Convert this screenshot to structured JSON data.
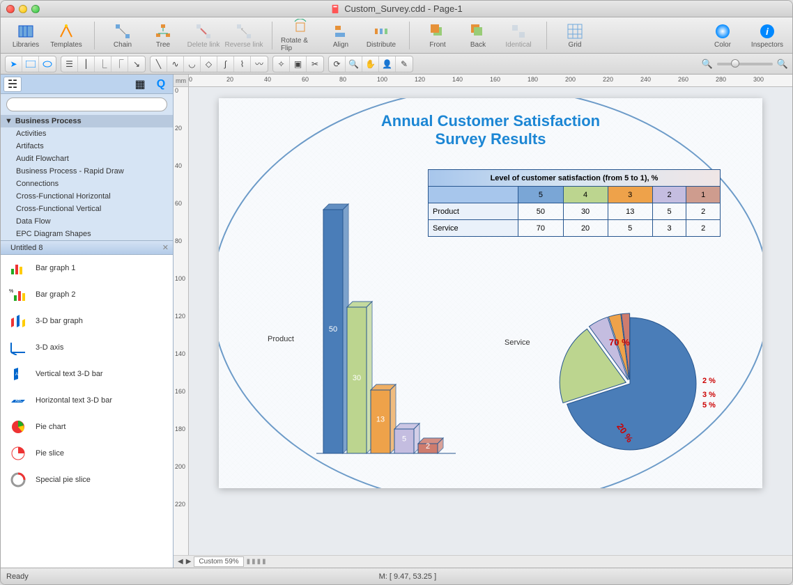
{
  "window": {
    "title": "Custom_Survey.cdd - Page-1"
  },
  "toolbar": {
    "libraries": "Libraries",
    "templates": "Templates",
    "chain": "Chain",
    "tree": "Tree",
    "delete_link": "Delete link",
    "reverse_link": "Reverse link",
    "rotate_flip": "Rotate & Flip",
    "align": "Align",
    "distribute": "Distribute",
    "front": "Front",
    "back": "Back",
    "identical": "Identical",
    "grid": "Grid",
    "color": "Color",
    "inspectors": "Inspectors"
  },
  "sidebar": {
    "search_placeholder": "",
    "root": "Business Process",
    "items": [
      "Activities",
      "Artifacts",
      "Audit Flowchart",
      "Business Process - Rapid Draw",
      "Connections",
      "Cross-Functional Horizontal",
      "Cross-Functional Vertical",
      "Data Flow",
      "EPC Diagram Shapes"
    ],
    "selected_lib": "Untitled 8",
    "shapes": [
      "Bar graph   1",
      "Bar graph   2",
      "3-D bar graph",
      "3-D axis",
      "Vertical text 3-D bar",
      "Horizontal text 3-D bar",
      "Pie chart",
      "Pie slice",
      "Special pie slice"
    ]
  },
  "ruler": {
    "unit": "mm"
  },
  "canvas": {
    "title_line1": "Annual Customer Satisfaction",
    "title_line2": "Survey Results",
    "table_header": "Level of customer satisfaction (from 5 to 1), %",
    "levels": [
      "5",
      "4",
      "3",
      "2",
      "1"
    ],
    "row_labels": [
      "Product",
      "Service"
    ],
    "bar_label": "Product",
    "pie_title": "Service"
  },
  "chart_data": [
    {
      "type": "table",
      "title": "Level of customer satisfaction (from 5 to 1), %",
      "columns": [
        "5",
        "4",
        "3",
        "2",
        "1"
      ],
      "rows": [
        {
          "label": "Product",
          "values": [
            50,
            30,
            13,
            5,
            2
          ]
        },
        {
          "label": "Service",
          "values": [
            70,
            20,
            5,
            3,
            2
          ]
        }
      ]
    },
    {
      "type": "bar",
      "title": "Product",
      "categories": [
        "5",
        "4",
        "3",
        "2",
        "1"
      ],
      "values": [
        50,
        30,
        13,
        5,
        2
      ],
      "colors": [
        "#4a7db8",
        "#bcd58f",
        "#eea24a",
        "#c4bde0",
        "#ce7c6e"
      ]
    },
    {
      "type": "pie",
      "title": "Service",
      "categories": [
        "5",
        "4",
        "3",
        "2",
        "1"
      ],
      "values": [
        70,
        20,
        5,
        3,
        2
      ],
      "labels": [
        "70 %",
        "20 %",
        "5 %",
        "3 %",
        "2 %"
      ],
      "colors": [
        "#4a7db8",
        "#bcd58f",
        "#c4bde0",
        "#eea24a",
        "#ce7c6e"
      ]
    }
  ],
  "bottom": {
    "zoom": "Custom 59%",
    "page_btns": [
      "◀",
      "▶"
    ]
  },
  "status": {
    "left": "Ready",
    "center": "M: [ 9.47, 53.25 ]"
  }
}
